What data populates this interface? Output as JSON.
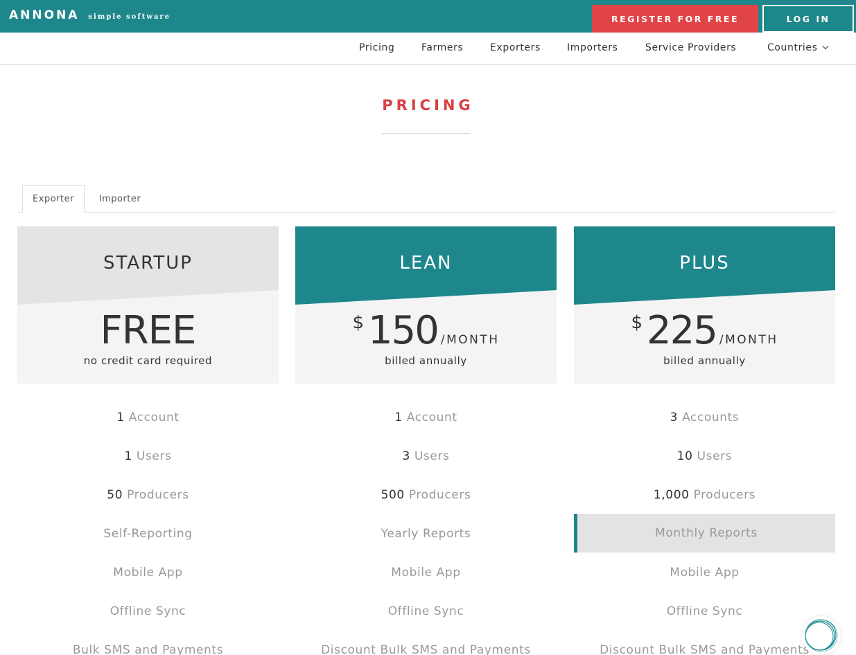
{
  "header": {
    "logo": "ANNONA",
    "tagline": "simple software",
    "register_label": "REGISTER FOR FREE",
    "login_label": "LOG IN"
  },
  "nav": {
    "items": [
      "Pricing",
      "Farmers",
      "Exporters",
      "Importers",
      "Service Providers",
      "Countries"
    ]
  },
  "page": {
    "title": "PRICING"
  },
  "tabs": [
    {
      "label": "Exporter",
      "active": true
    },
    {
      "label": "Importer",
      "active": false
    }
  ],
  "plans": [
    {
      "name": "STARTUP",
      "price": "FREE",
      "note": "no credit card required",
      "features": [
        {
          "num": "1",
          "text": "Account"
        },
        {
          "num": "1",
          "text": "Users"
        },
        {
          "num": "50",
          "text": "Producers"
        },
        {
          "num": "",
          "text": "Self-Reporting"
        },
        {
          "num": "",
          "text": "Mobile App"
        },
        {
          "num": "",
          "text": "Offline Sync"
        },
        {
          "num": "",
          "text": "Bulk SMS and Payments"
        }
      ]
    },
    {
      "name": "LEAN",
      "currency": "$",
      "price": "150",
      "period": "/MONTH",
      "note": "billed annually",
      "features": [
        {
          "num": "1",
          "text": "Account"
        },
        {
          "num": "3",
          "text": "Users"
        },
        {
          "num": "500",
          "text": "Producers"
        },
        {
          "num": "",
          "text": "Yearly Reports"
        },
        {
          "num": "",
          "text": "Mobile App"
        },
        {
          "num": "",
          "text": "Offline Sync"
        },
        {
          "num": "",
          "text": "Discount Bulk SMS and Payments"
        }
      ]
    },
    {
      "name": "PLUS",
      "currency": "$",
      "price": "225",
      "period": "/MONTH",
      "note": "billed annually",
      "features": [
        {
          "num": "3",
          "text": "Accounts"
        },
        {
          "num": "10",
          "text": "Users"
        },
        {
          "num": "1,000",
          "text": "Producers"
        },
        {
          "num": "",
          "text": "Monthly Reports"
        },
        {
          "num": "",
          "text": "Mobile App"
        },
        {
          "num": "",
          "text": "Offline Sync"
        },
        {
          "num": "",
          "text": "Discount Bulk SMS and Payments"
        }
      ]
    }
  ],
  "colors": {
    "teal": "#1e878c",
    "red": "#e04446",
    "grey_header": "#e4e4e4",
    "card_bg": "#f4f4f4"
  }
}
